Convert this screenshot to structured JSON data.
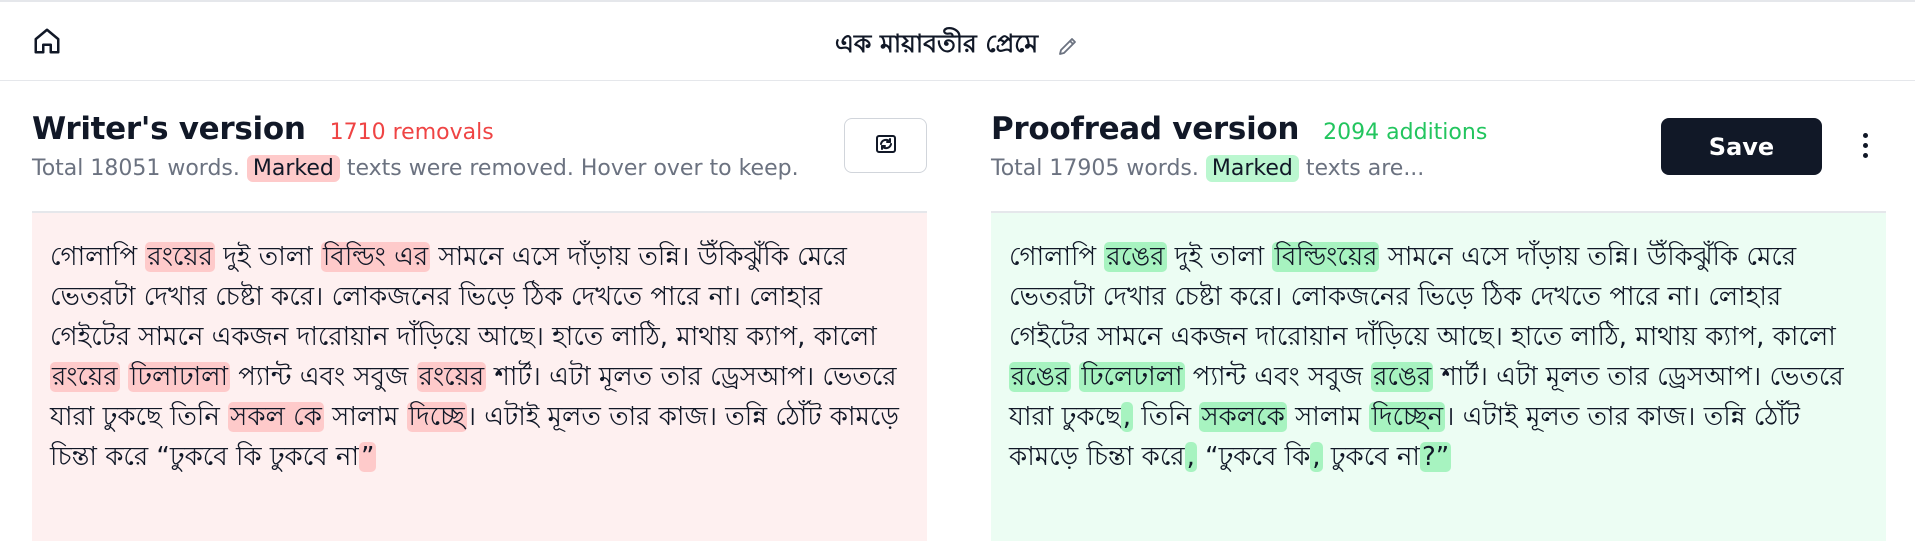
{
  "header": {
    "title": "এক মায়াবতীর প্রেমে",
    "home_icon": "home-icon",
    "edit_icon": "pencil-icon"
  },
  "writer": {
    "title": "Writer's version",
    "count": "1710 removals",
    "sub_before": "Total 18051 words.",
    "sub_tag": "Marked",
    "sub_after": "texts were removed. Hover over to keep.",
    "swap_icon": "swap-icon",
    "segments": [
      {
        "t": "গোলাপি ",
        "m": false
      },
      {
        "t": "রংয়ের",
        "m": true
      },
      {
        "t": " দুই তালা ",
        "m": false
      },
      {
        "t": "বিল্ডিং এর",
        "m": true
      },
      {
        "t": " সামনে এসে দাঁড়ায় তন্নি। উঁকিঝুঁকি মেরে ভেতরটা দেখার চেষ্টা করে। লোকজনের ভিড়ে ঠিক দেখতে পারে না। লোহার গেইটের সামনে একজন দারোয়ান দাঁড়িয়ে আছে। হাতে লাঠি, মাথায় ক্যাপ, কালো ",
        "m": false
      },
      {
        "t": "রংয়ের",
        "m": true
      },
      {
        "t": " ",
        "m": false
      },
      {
        "t": "ঢিলাঢালা",
        "m": true
      },
      {
        "t": " প্যান্ট এবং সবুজ ",
        "m": false
      },
      {
        "t": "রংয়ের",
        "m": true
      },
      {
        "t": " শার্ট। এটা মূলত তার ড্রেসআপ। ভেতরে যারা ঢুকছে তিনি ",
        "m": false
      },
      {
        "t": "সকল কে",
        "m": true
      },
      {
        "t": " সালাম ",
        "m": false
      },
      {
        "t": "দিচ্ছে",
        "m": true
      },
      {
        "t": "। এটাই মূলত তার কাজ। তন্নি ঠোঁট কামড়ে চিন্তা করে “ঢুকবে কি ঢুকবে না",
        "m": false
      },
      {
        "t": "”",
        "m": true
      }
    ]
  },
  "proofread": {
    "title": "Proofread version",
    "count": "2094 additions",
    "sub_before": "Total 17905 words.",
    "sub_tag": "Marked",
    "sub_after": "texts are...",
    "save_label": "Save",
    "menu_icon": "more-vertical-icon",
    "segments": [
      {
        "t": "গোলাপি ",
        "m": false
      },
      {
        "t": "রঙের",
        "m": true
      },
      {
        "t": " দুই তালা ",
        "m": false
      },
      {
        "t": "বিল্ডিংয়ের",
        "m": true
      },
      {
        "t": " সামনে এসে দাঁড়ায় তন্নি। উঁকিঝুঁকি মেরে ভেতরটা দেখার চেষ্টা করে। লোকজনের ভিড়ে ঠিক দেখতে পারে না। লোহার গেইটের সামনে একজন দারোয়ান দাঁড়িয়ে আছে। হাতে লাঠি, মাথায় ক্যাপ, কালো ",
        "m": false
      },
      {
        "t": "রঙের",
        "m": true
      },
      {
        "t": " ",
        "m": false
      },
      {
        "t": "ঢিলেঢালা",
        "m": true
      },
      {
        "t": " প্যান্ট এবং সবুজ ",
        "m": false
      },
      {
        "t": "রঙের",
        "m": true
      },
      {
        "t": " শার্ট। এটা মূলত তার ড্রেসআপ। ভেতরে যারা ঢুকছে",
        "m": false
      },
      {
        "t": ",",
        "m": true
      },
      {
        "t": " তিনি ",
        "m": false
      },
      {
        "t": "সকলকে",
        "m": true
      },
      {
        "t": " সালাম ",
        "m": false
      },
      {
        "t": "দিচ্ছেন",
        "m": true
      },
      {
        "t": "। এটাই মূলত তার কাজ। তন্নি ঠোঁট কামড়ে চিন্তা করে",
        "m": false
      },
      {
        "t": ",",
        "m": true
      },
      {
        "t": " “ঢুকবে কি",
        "m": false
      },
      {
        "t": ",",
        "m": true
      },
      {
        "t": " ঢুকবে না",
        "m": false
      },
      {
        "t": "?”",
        "m": true
      }
    ]
  },
  "colors": {
    "removed_bg": "#fef0f0",
    "removed_mark": "#fecaca",
    "removed_count": "#ef4444",
    "added_bg": "#ecfdf3",
    "added_mark": "#a7f3c0",
    "added_count": "#22c55e",
    "save_button": "#111827"
  }
}
